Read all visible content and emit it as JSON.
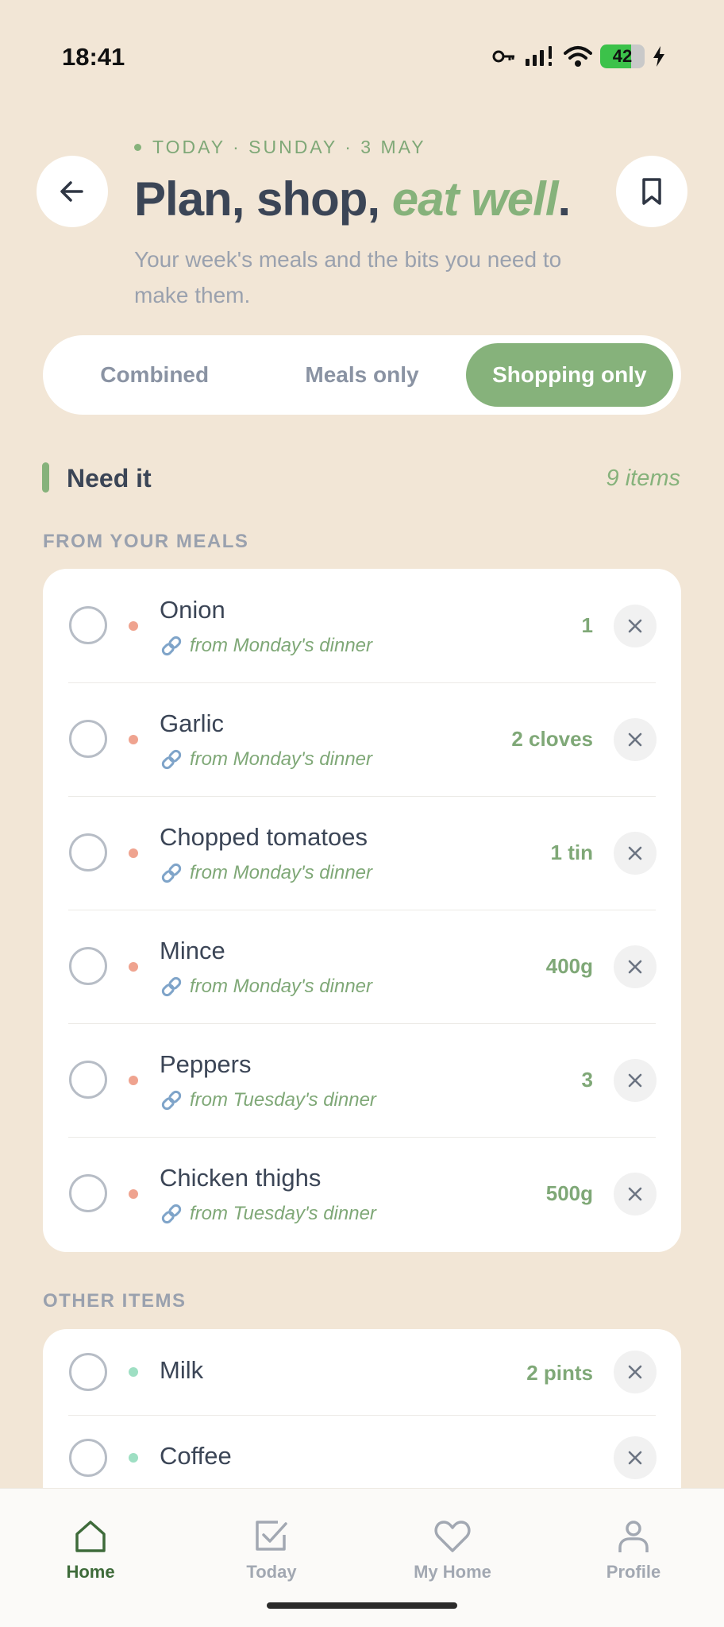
{
  "status_bar": {
    "time": "18:41",
    "battery": "42",
    "icons": [
      "vpn-key-icon",
      "signal-icon",
      "wifi-icon",
      "battery-icon",
      "charging-icon"
    ]
  },
  "header": {
    "date_line": "TODAY · SUNDAY · 3 MAY",
    "title_part1": "Plan, shop, ",
    "title_accent": "eat well",
    "title_end": ".",
    "subtitle": "Your week's meals and the bits you need to make them.",
    "back_icon": "arrow-left-icon",
    "bookmark_icon": "bookmark-icon"
  },
  "segmented": {
    "options": [
      "Combined",
      "Meals only",
      "Shopping only"
    ],
    "selected": "Shopping only"
  },
  "section": {
    "title": "Need it",
    "count": "9 items"
  },
  "meals_group": {
    "label": "FROM YOUR MEALS",
    "items": [
      {
        "name": "Onion",
        "source": "from Monday's dinner",
        "qty": "1"
      },
      {
        "name": "Garlic",
        "source": "from Monday's dinner",
        "qty": "2 cloves"
      },
      {
        "name": "Chopped tomatoes",
        "source": "from Monday's dinner",
        "qty": "1 tin"
      },
      {
        "name": "Mince",
        "source": "from Monday's dinner",
        "qty": "400g"
      },
      {
        "name": "Peppers",
        "source": "from Tuesday's dinner",
        "qty": "3"
      },
      {
        "name": "Chicken thighs",
        "source": "from Tuesday's dinner",
        "qty": "500g"
      }
    ]
  },
  "other_group": {
    "label": "OTHER ITEMS",
    "items": [
      {
        "name": "Milk",
        "qty": "2 pints"
      },
      {
        "name": "Coffee",
        "qty": ""
      }
    ]
  },
  "bottom_nav": {
    "items": [
      {
        "label": "Home",
        "icon": "home-icon",
        "active": true
      },
      {
        "label": "Today",
        "icon": "checkbox-icon",
        "active": false
      },
      {
        "label": "My Home",
        "icon": "heart-icon",
        "active": false
      },
      {
        "label": "Profile",
        "icon": "person-icon",
        "active": false
      }
    ]
  },
  "colors": {
    "background": "#F2E6D6",
    "accent_green": "#86B27B",
    "text_dark": "#3B4556",
    "meal_dot": "#EFA38F",
    "other_dot": "#9EDFC3"
  }
}
